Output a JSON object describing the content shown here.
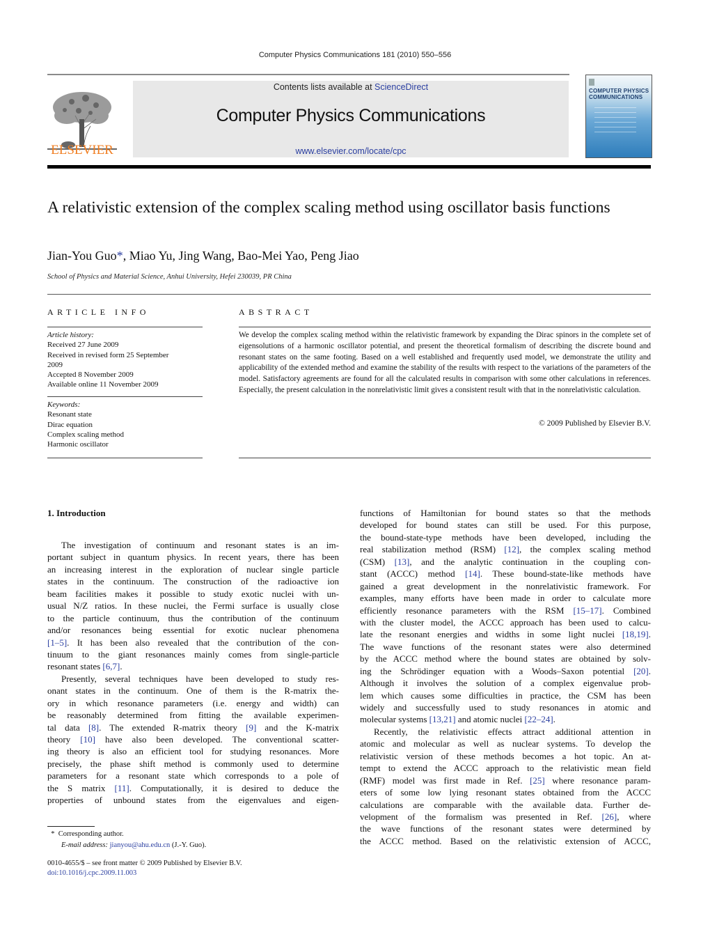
{
  "header": {
    "journal_reference": "Computer Physics Communications 181 (2010) 550–556",
    "contents_prefix": "Contents lists available at ",
    "contents_link": "ScienceDirect",
    "journal_title": "Computer Physics Communications",
    "journal_url": "www.elsevier.com/locate/cpc",
    "publisher_logo_text": "ELSEVIER",
    "cover_title_line1": "COMPUTER PHYSICS",
    "cover_title_line2": "COMMUNICATIONS",
    "colors": {
      "publisher_orange": "#f07d20",
      "link_blue": "#2a3ea0",
      "banner_gray": "#e8e8e8"
    }
  },
  "article": {
    "title": "A relativistic extension of the complex scaling method using oscillator basis functions",
    "authors_first": "Jian-You Guo",
    "corresponding_mark": "*",
    "authors_rest": ", Miao Yu, Jing Wang, Bao-Mei Yao, Peng Jiao",
    "affiliation": "School of Physics and Material Science, Anhui University, Hefei 230039, PR China"
  },
  "article_info": {
    "heading": "ARTICLE INFO",
    "history_label": "Article history:",
    "history": [
      "Received 27 June 2009",
      "Received in revised form 25 September",
      "2009",
      "Accepted 8 November 2009",
      "Available online 11 November 2009"
    ],
    "keywords_label": "Keywords:",
    "keywords": [
      "Resonant state",
      "Dirac equation",
      "Complex scaling method",
      "Harmonic oscillator"
    ]
  },
  "abstract": {
    "heading": "ABSTRACT",
    "text": "We develop the complex scaling method within the relativistic framework by expanding the Dirac spinors in the complete set of eigensolutions of a harmonic oscillator potential, and present the theoretical formalism of describing the discrete bound and resonant states on the same footing. Based on a well established and frequently used model, we demonstrate the utility and applicability of the extended method and examine the stability of the results with respect to the variations of the parameters of the model. Satisfactory agreements are found for all the calculated results in comparison with some other calculations in references. Especially, the present calculation in the nonrelativistic limit gives a consistent result with that in the nonrelativistic calculation.",
    "copyright": "© 2009 Published by Elsevier B.V."
  },
  "body": {
    "section_heading": "1.  Introduction",
    "left_column_lines": [
      {
        "t": "The investigation of continuum and resonant states is an im-",
        "indent": true
      },
      {
        "t": "portant subject in quantum physics. In recent years, there has been"
      },
      {
        "t": "an increasing interest in the exploration of nuclear single particle"
      },
      {
        "t": "states in the continuum. The construction of the radioactive ion"
      },
      {
        "t": "beam facilities makes it possible to study exotic nuclei with un-"
      },
      {
        "t": "usual N/Z ratios. In these nuclei, the Fermi surface is usually close"
      },
      {
        "t": "to the particle continuum, thus the contribution of the continuum"
      },
      {
        "t": "and/or resonances being essential for exotic nuclear phenomena"
      },
      {
        "t": "",
        "ref": "[1–5]",
        "after": ". It has been also revealed that the contribution of the con-"
      },
      {
        "t": "tinuum to the giant resonances mainly comes from single-particle"
      },
      {
        "t": "resonant states ",
        "ref": "[6,7]",
        "after": ".",
        "last": true
      },
      {
        "t": "Presently, several techniques have been developed to study res-",
        "indent": true
      },
      {
        "t": "onant states in the continuum. One of them is the R-matrix the-"
      },
      {
        "t": "ory in which resonance parameters (i.e. energy and width) can"
      },
      {
        "t": "be reasonably determined from fitting the available experimen-"
      },
      {
        "t": "tal data ",
        "ref": "[8]",
        "after": ". The extended R-matrix theory ",
        "ref2": "[9]",
        "after2": " and the K-matrix"
      },
      {
        "t": "theory ",
        "ref": "[10]",
        "after": " have also been developed. The conventional scatter-"
      },
      {
        "t": "ing theory is also an efficient tool for studying resonances. More"
      },
      {
        "t": "precisely, the phase shift method is commonly used to determine"
      },
      {
        "t": "parameters for a resonant state which corresponds to a pole of"
      },
      {
        "t": "the S matrix ",
        "ref": "[11]",
        "after": ". Computationally, it is desired to deduce the"
      },
      {
        "t": "properties of unbound states from the eigenvalues and eigen-"
      }
    ],
    "right_column_lines": [
      {
        "t": "functions of Hamiltonian for bound states so that the methods"
      },
      {
        "t": "developed for bound states can still be used. For this purpose,"
      },
      {
        "t": "the bound-state-type methods have been developed, including the"
      },
      {
        "t": "real stabilization method (RSM) ",
        "ref": "[12]",
        "after": ", the complex scaling method"
      },
      {
        "t": "(CSM) ",
        "ref": "[13]",
        "after": ", and the analytic continuation in the coupling con-"
      },
      {
        "t": "stant (ACCC) method ",
        "ref": "[14]",
        "after": ". These bound-state-like methods have"
      },
      {
        "t": "gained a great development in the nonrelativistic framework. For"
      },
      {
        "t": "examples, many efforts have been made in order to calculate more"
      },
      {
        "t": "efficiently resonance parameters with the RSM ",
        "ref": "[15–17]",
        "after": ". Combined"
      },
      {
        "t": "with the cluster model, the ACCC approach has been used to calcu-"
      },
      {
        "t": "late the resonant energies and widths in some light nuclei ",
        "ref": "[18,19]",
        "after": "."
      },
      {
        "t": "The wave functions of the resonant states were also determined"
      },
      {
        "t": "by the ACCC method where the bound states are obtained by solv-"
      },
      {
        "t": "ing the Schrödinger equation with a Woods–Saxon potential ",
        "ref": "[20]",
        "after": "."
      },
      {
        "t": "Although it involves the solution of a complex eigenvalue prob-"
      },
      {
        "t": "lem which causes some difficulties in practice, the CSM has been"
      },
      {
        "t": "widely and successfully used to study resonances in atomic and"
      },
      {
        "t": "molecular systems ",
        "ref": "[13,21]",
        "after": " and atomic nuclei ",
        "ref2": "[22–24]",
        "after2": ".",
        "last": true
      },
      {
        "t": "Recently, the relativistic effects attract additional attention in",
        "indent": true
      },
      {
        "t": "atomic and molecular as well as nuclear systems. To develop the"
      },
      {
        "t": "relativistic version of these methods becomes a hot topic. An at-"
      },
      {
        "t": "tempt to extend the ACCC approach to the relativistic mean field"
      },
      {
        "t": "(RMF) model was first made in Ref. ",
        "ref": "[25]",
        "after": " where resonance param-"
      },
      {
        "t": "eters of some low lying resonant states obtained from the ACCC"
      },
      {
        "t": "calculations are comparable with the available data. Further de-"
      },
      {
        "t": "velopment of the formalism was presented in Ref. ",
        "ref": "[26]",
        "after": ", where"
      },
      {
        "t": "the wave functions of the resonant states were determined by"
      },
      {
        "t": "the ACCC method. Based on the relativistic extension of ACCC,"
      }
    ]
  },
  "footnote": {
    "mark": "*",
    "corresponding": "Corresponding author.",
    "email_label": "E-mail address:",
    "email": "jianyou@ahu.edu.cn",
    "email_suffix": " (J.-Y. Guo).",
    "front_matter": "0010-4655/$ – see front matter  © 2009 Published by Elsevier B.V.",
    "doi": "doi:10.1016/j.cpc.2009.11.003"
  }
}
